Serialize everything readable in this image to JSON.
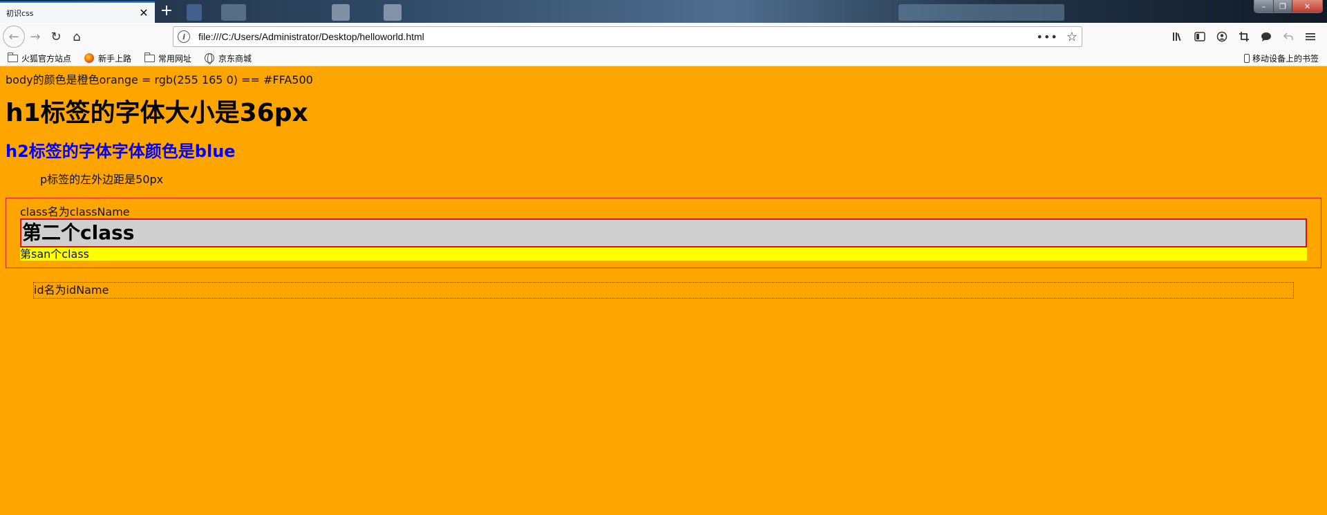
{
  "browser": {
    "tab": {
      "title": "初识css",
      "close_glyph": "✕"
    },
    "new_tab_glyph": "+",
    "window_controls": {
      "minimize": "–",
      "restore": "❐",
      "close": "✕"
    },
    "nav": {
      "back": "←",
      "forward": "→",
      "reload": "↻",
      "home": "⌂",
      "url": "file:///C:/Users/Administrator/Desktop/helloworld.html",
      "page_actions": "•••",
      "bookmark_star": "☆"
    },
    "toolbar_icons": [
      "library-icon",
      "sidebar-icon",
      "account-icon",
      "screenshot-icon",
      "chat-icon",
      "undo-icon",
      "menu-icon"
    ],
    "bookmarks": [
      {
        "label": "火狐官方站点",
        "icon": "folder-icon"
      },
      {
        "label": "新手上路",
        "icon": "firefox-icon"
      },
      {
        "label": "常用网址",
        "icon": "folder-icon"
      },
      {
        "label": "京东商城",
        "icon": "globe-icon"
      }
    ],
    "mobile_bookmarks": "移动设备上的书签"
  },
  "content": {
    "intro": "body的颜色是橙色orange = rgb(255 165 0) == #FFA500",
    "h1": "h1标签的字体大小是36px",
    "h2": "h2标签的字体字体颜色是blue",
    "para": "p标签的左外边距是50px",
    "class_label": "class名为className",
    "second_class": "第二个class",
    "third_class": "第san个class",
    "id_label": "id名为idName"
  },
  "colors": {
    "background": "#FFA500",
    "h2": "#0000FF",
    "border": "#E02020",
    "second_bg": "#CFCFCF",
    "third_bg": "#FFFF00"
  }
}
